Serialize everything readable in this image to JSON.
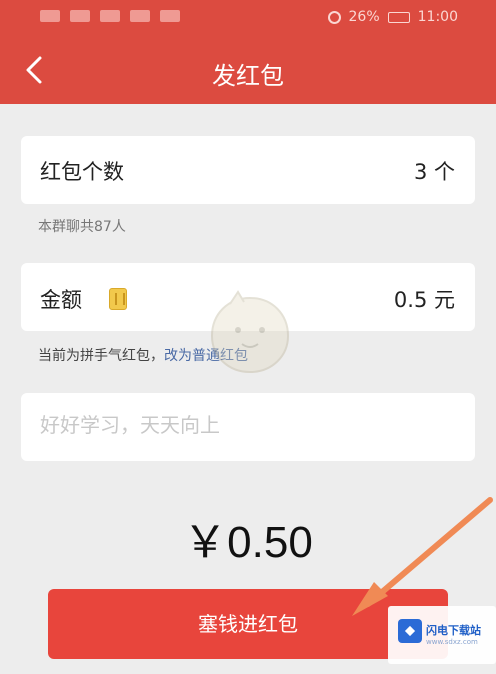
{
  "status_bar": {
    "battery": "26%",
    "time": "11:00"
  },
  "nav": {
    "title": "发红包"
  },
  "packet_count": {
    "label": "红包个数",
    "value": "3 个"
  },
  "members_hint": "本群聊共87人",
  "amount": {
    "label": "金额",
    "value": "0.5 元"
  },
  "mode_hint": {
    "text": "当前为拼手气红包，",
    "switch_link": "改为普通红包"
  },
  "greeting": {
    "placeholder": "好好学习，天天向上"
  },
  "total": "￥0.50",
  "send_button": "塞钱进红包",
  "watermark": {
    "text": "闪电下载站",
    "sub": "www.sdxz.com"
  },
  "colors": {
    "header": "#dc4b40",
    "button": "#e8453c",
    "background": "#ededed",
    "link": "#4a6aa5",
    "annotation_arrow": "#f08a55"
  }
}
